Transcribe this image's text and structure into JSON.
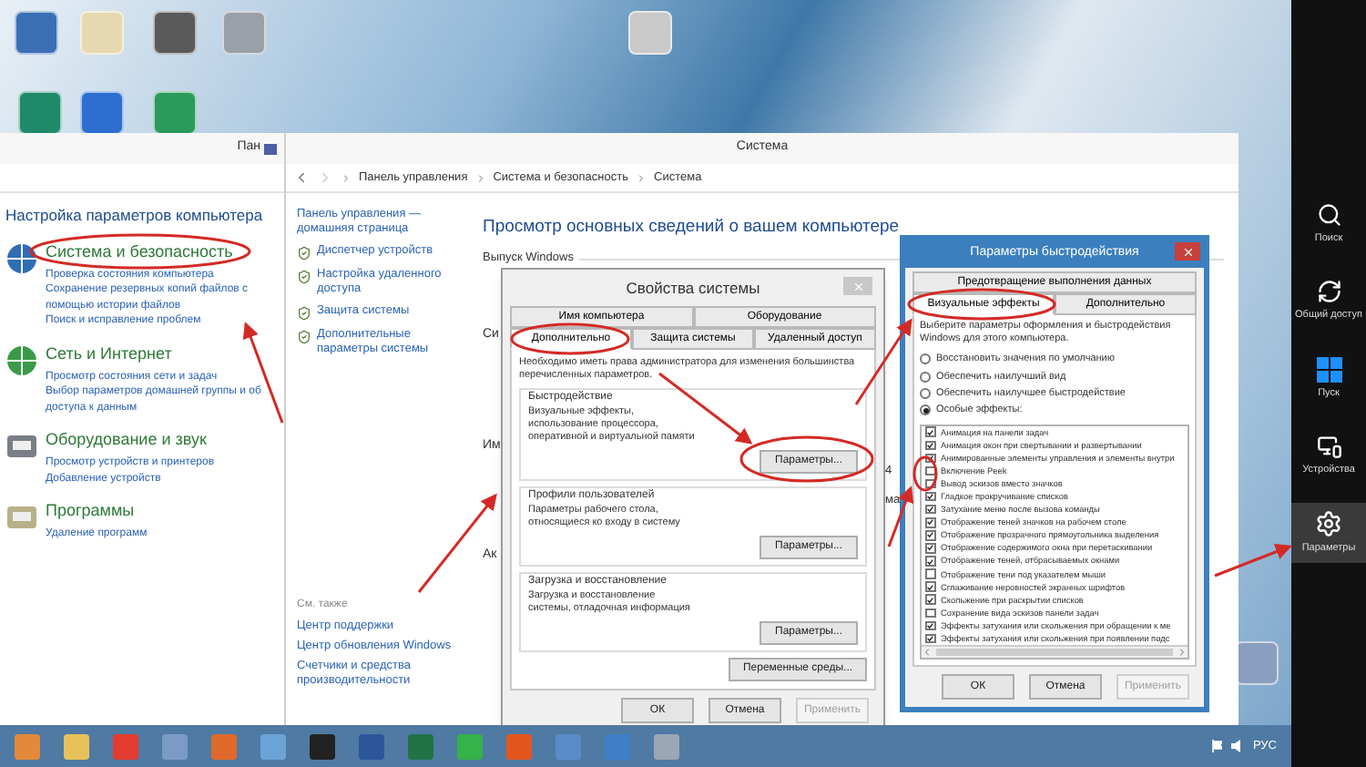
{
  "control_panel": {
    "title": "Пан",
    "heading": "Настройка параметров компьютера",
    "categories": [
      {
        "kind": "security",
        "title": "Система и безопасность",
        "links": [
          "Проверка состояния компьютера",
          "Сохранение резервных копий файлов с помощью истории файлов",
          "Поиск и исправление проблем"
        ]
      },
      {
        "kind": "network",
        "title": "Сеть и Интернет",
        "links": [
          "Просмотр состояния сети и задач",
          "Выбор параметров домашней группы и об",
          "доступа к данным"
        ]
      },
      {
        "kind": "hardware",
        "title": "Оборудование и звук",
        "links": [
          "Просмотр устройств и принтеров",
          "Добавление устройств"
        ]
      },
      {
        "kind": "programs",
        "title": "Программы",
        "links": [
          "Удаление программ"
        ]
      }
    ]
  },
  "system_window": {
    "title": "Система",
    "breadcrumb": [
      "Панель управления",
      "Система и безопасность",
      "Система"
    ],
    "home_link": "Панель управления — домашняя страница",
    "sidebar_items": [
      "Диспетчер устройств",
      "Настройка удаленного доступа",
      "Защита системы",
      "Дополнительные параметры системы"
    ],
    "see_also": {
      "title": "См. также",
      "links": [
        "Центр поддержки",
        "Центр обновления Windows",
        "Счетчики и средства производительности"
      ]
    },
    "heading": "Просмотр основных сведений о вашем компьютере",
    "edition_label": "Выпуск Windows",
    "partial_labels": [
      "Си",
      "Им",
      "Ак"
    ],
    "right_labels": [
      "4",
      "ма"
    ]
  },
  "system_properties": {
    "title": "Свойства системы",
    "tab_rows": [
      [
        {
          "label": "Имя компьютера",
          "selected": false
        },
        {
          "label": "Оборудование",
          "selected": false
        }
      ],
      [
        {
          "label": "Дополнительно",
          "selected": true
        },
        {
          "label": "Защита системы",
          "selected": false
        },
        {
          "label": "Удаленный доступ",
          "selected": false
        }
      ]
    ],
    "note": "Необходимо иметь права администратора для изменения большинства перечисленных параметров.",
    "groups": [
      {
        "title": "Быстродействие",
        "text": "Визуальные эффекты, использование процессора, оперативной и виртуальной памяти",
        "button": "Параметры..."
      },
      {
        "title": "Профили пользователей",
        "text": "Параметры рабочего стола, относящиеся ко входу в систему",
        "button": "Параметры..."
      },
      {
        "title": "Загрузка и восстановление",
        "text": "Загрузка и восстановление системы, отладочная информация",
        "button": "Параметры..."
      }
    ],
    "env_button": "Переменные среды...",
    "buttons": [
      {
        "label": "ОК",
        "disabled": false
      },
      {
        "label": "Отмена",
        "disabled": false
      },
      {
        "label": "Применить",
        "disabled": true
      }
    ]
  },
  "performance_options": {
    "title": "Параметры быстродействия",
    "tab_rows": [
      [
        {
          "label": "Предотвращение выполнения данных",
          "selected": false
        }
      ],
      [
        {
          "label": "Визуальные эффекты",
          "selected": true
        },
        {
          "label": "Дополнительно",
          "selected": false
        }
      ]
    ],
    "intro": "Выберите параметры оформления и быстродействия Windows для этого компьютера.",
    "radios": [
      {
        "label": "Восстановить значения по умолчанию",
        "selected": false
      },
      {
        "label": "Обеспечить наилучший вид",
        "selected": false
      },
      {
        "label": "Обеспечить наилучшее быстродействие",
        "selected": false
      },
      {
        "label": "Особые эффекты:",
        "selected": true
      }
    ],
    "effects": [
      {
        "label": "Анимация на панели задач",
        "checked": true
      },
      {
        "label": "Анимация окон при свертывании и развертывании",
        "checked": true
      },
      {
        "label": "Анимированные элементы управления и элементы внутри",
        "checked": true
      },
      {
        "label": "Включение Peek",
        "checked": false
      },
      {
        "label": "Вывод эскизов вместо значков",
        "checked": false
      },
      {
        "label": "Гладкое прокручивание списков",
        "checked": true
      },
      {
        "label": "Затухание меню после вызова команды",
        "checked": true
      },
      {
        "label": "Отображение теней значков на рабочем столе",
        "checked": true
      },
      {
        "label": "Отображение прозрачного прямоугольника выделения",
        "checked": true
      },
      {
        "label": "Отображение содержимого окна при перетаскивании",
        "checked": true
      },
      {
        "label": "Отображение теней, отбрасываемых окнами",
        "checked": true
      },
      {
        "label": "Отображение тени под указателем мыши",
        "checked": false
      },
      {
        "label": "Сглаживание неровностей экранных шрифтов",
        "checked": true
      },
      {
        "label": "Скольжение при раскрытии списков",
        "checked": true
      },
      {
        "label": "Сохранение вида эскизов панели задач",
        "checked": false
      },
      {
        "label": "Эффекты затухания или скольжения при обращении к ме",
        "checked": true
      },
      {
        "label": "Эффекты затухания или скольжения при появлении подс",
        "checked": true
      }
    ],
    "buttons": [
      {
        "label": "ОК",
        "disabled": false
      },
      {
        "label": "Отмена",
        "disabled": false
      },
      {
        "label": "Применить",
        "disabled": true
      }
    ]
  },
  "charms": [
    {
      "kind": "search",
      "label": "Поиск",
      "selected": false
    },
    {
      "kind": "share",
      "label": "Общий доступ",
      "selected": false
    },
    {
      "kind": "start",
      "label": "Пуск",
      "selected": false
    },
    {
      "kind": "devices",
      "label": "Устройства",
      "selected": false
    },
    {
      "kind": "settings",
      "label": "Параметры",
      "selected": true
    }
  ],
  "taskbar": {
    "language": "РУС"
  }
}
